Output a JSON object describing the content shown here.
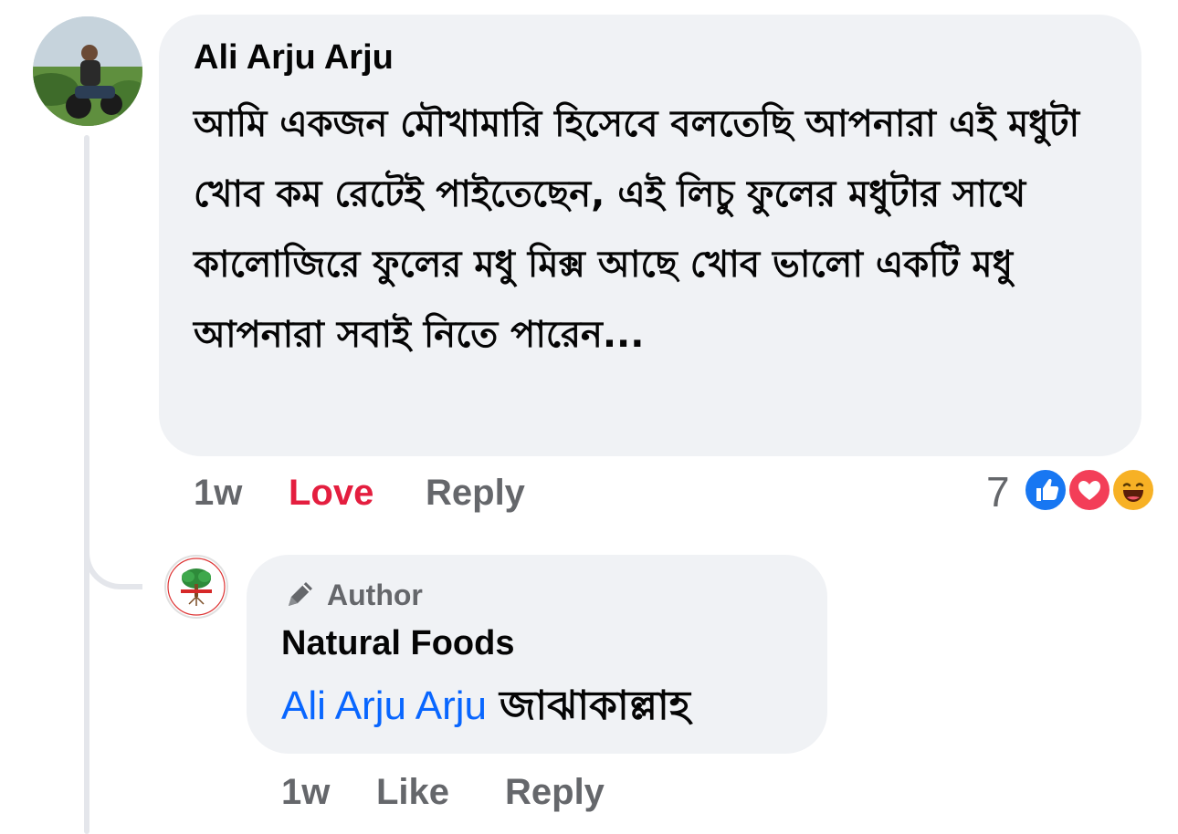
{
  "comment": {
    "author": "Ali Arju Arju",
    "text": "আমি একজন মৌখামারি হিসেবে বলতেছি আপনারা এই মধুটা খোব কম রেটেই পাইতেছেন, এই লিচু ফুলের মধুটার সাথে কালোজিরে ফুলের মধু মিক্স আছে খোব ভালো একটি মধু আপনারা সবাই নিতে পারেন...",
    "time": "1w",
    "love_label": "Love",
    "reply_label": "Reply",
    "reaction_count": "7",
    "reactions": [
      "like-icon",
      "love-icon",
      "haha-icon"
    ],
    "colors": {
      "bubble": "#f0f2f5",
      "love": "#e41e3f",
      "meta": "#65676b",
      "like": "#1877f2",
      "heart": "#f33e58",
      "haha": "#f7b125"
    }
  },
  "reply": {
    "badge": "Author",
    "author": "Natural Foods",
    "mention": "Ali Arju Arju",
    "text": "জাঝাকাল্লাহ",
    "time": "1w",
    "like_label": "Like",
    "reply_label": "Reply",
    "colors": {
      "mention": "#0866ff"
    }
  }
}
